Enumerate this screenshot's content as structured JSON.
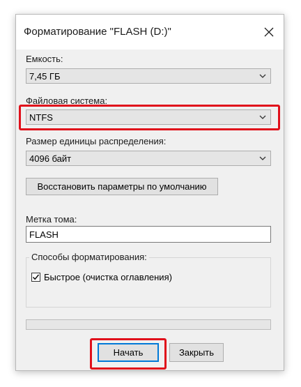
{
  "window": {
    "title": "Форматирование \"FLASH (D:)\""
  },
  "capacity": {
    "label": "Емкость:",
    "value": "7,45 ГБ"
  },
  "filesystem": {
    "label": "Файловая система:",
    "value": "NTFS"
  },
  "allocation": {
    "label": "Размер единицы распределения:",
    "value": "4096 байт"
  },
  "restore_defaults_label": "Восстановить параметры по умолчанию",
  "volume": {
    "label": "Метка тома:",
    "value": "FLASH"
  },
  "format_options": {
    "title": "Способы форматирования:",
    "quick_format_label": "Быстрое (очистка оглавления)",
    "quick_format_checked": true
  },
  "progress": {
    "value_percent": 0
  },
  "buttons": {
    "start_label": "Начать",
    "close_label": "Закрыть"
  },
  "colors": {
    "highlight": "#e0101b",
    "accent": "#0078d7"
  },
  "icons": {
    "close": "close-icon",
    "dropdown": "chevron-down-icon",
    "check": "checkmark-icon"
  }
}
